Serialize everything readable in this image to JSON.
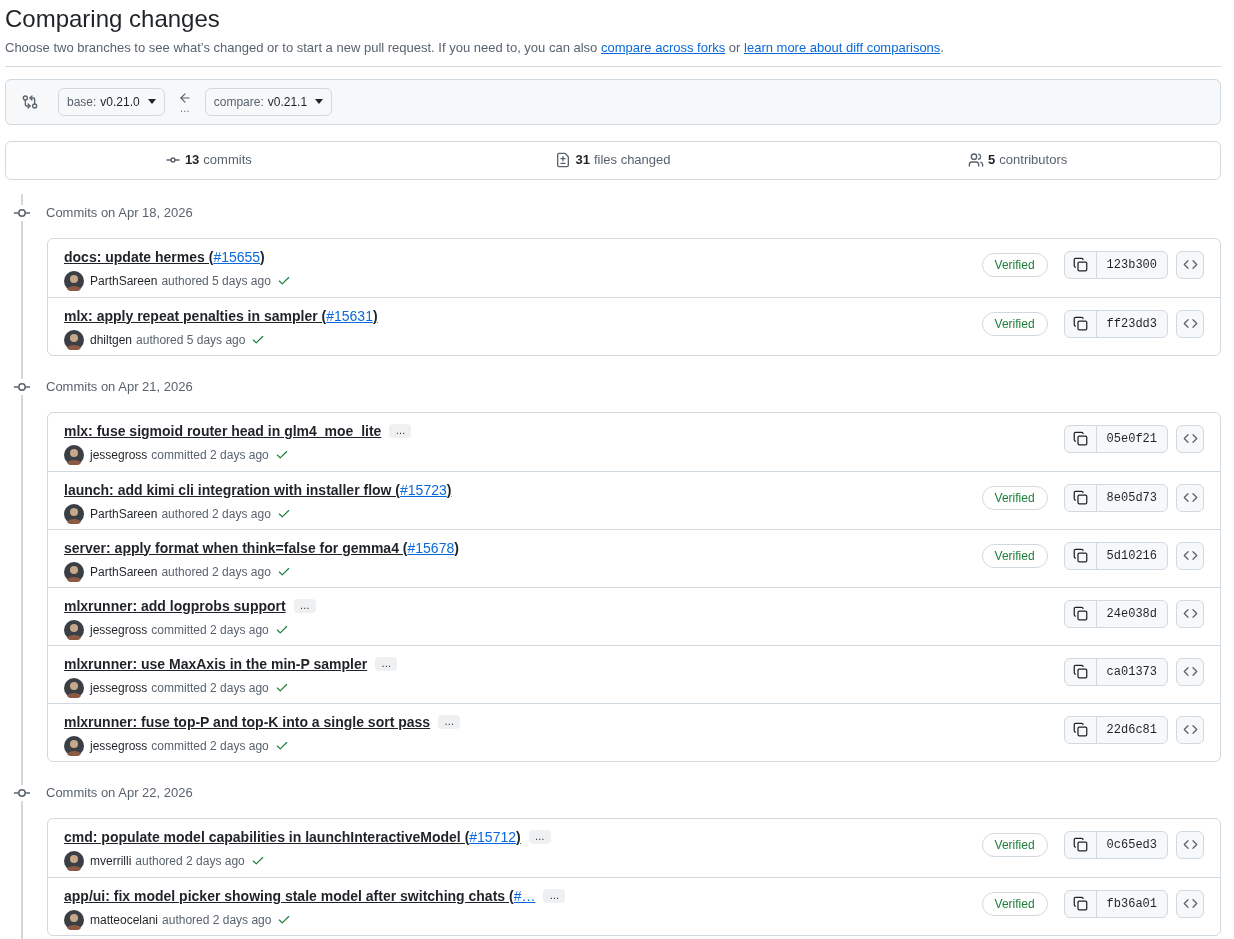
{
  "page": {
    "title": "Comparing changes",
    "description": [
      {
        "kind": "text",
        "text": "Choose two branches to see what’s changed or to start a new pull request. If you need to, you can also "
      },
      {
        "kind": "link",
        "text": "compare across forks"
      },
      {
        "kind": "text",
        "text": " or "
      },
      {
        "kind": "link",
        "text": "learn more about diff comparisons"
      },
      {
        "kind": "text",
        "text": "."
      }
    ]
  },
  "range": {
    "base": {
      "label": "base:",
      "value": "v0.21.0"
    },
    "compare": {
      "label": "compare:",
      "value": "v0.21.1"
    },
    "arrow_caption": "…"
  },
  "summary": [
    {
      "kind": "commits",
      "count": "13",
      "label": "commits"
    },
    {
      "kind": "files",
      "count": "31",
      "label": "files changed"
    },
    {
      "kind": "contributors",
      "count": "5",
      "label": "contributors"
    }
  ],
  "groups": [
    {
      "heading": "Commits on Apr 18, 2026",
      "commits": [
        {
          "title": "docs: update hermes (",
          "pr": "#15655",
          "title_end": ")",
          "author": "ParthSareen",
          "action": "authored",
          "time": "5 days ago",
          "verified": "Verified",
          "sha": "123b300"
        },
        {
          "title": "mlx: apply repeat penalties in sampler (",
          "pr": "#15631",
          "title_end": ")",
          "author": "dhiltgen",
          "action": "authored",
          "time": "5 days ago",
          "verified": "Verified",
          "sha": "ff23dd3"
        }
      ]
    },
    {
      "heading": "Commits on Apr 21, 2026",
      "commits": [
        {
          "title": "mlx: fuse sigmoid router head in glm4_moe_lite",
          "more": "…",
          "author": "jessegross",
          "action": "committed",
          "time": "2 days ago",
          "sha": "05e0f21"
        },
        {
          "title": "launch: add kimi cli integration with installer flow (",
          "pr": "#15723",
          "title_end": ")",
          "author": "ParthSareen",
          "action": "authored",
          "time": "2 days ago",
          "verified": "Verified",
          "sha": "8e05d73"
        },
        {
          "title": "server: apply format when think=false for gemma4 (",
          "pr": "#15678",
          "title_end": ")",
          "author": "ParthSareen",
          "action": "authored",
          "time": "2 days ago",
          "verified": "Verified",
          "sha": "5d10216"
        },
        {
          "title": "mlxrunner: add logprobs support",
          "more": "…",
          "author": "jessegross",
          "action": "committed",
          "time": "2 days ago",
          "sha": "24e038d"
        },
        {
          "title": "mlxrunner: use MaxAxis in the min-P sampler",
          "more": "…",
          "author": "jessegross",
          "action": "committed",
          "time": "2 days ago",
          "sha": "ca01373"
        },
        {
          "title": "mlxrunner: fuse top-P and top-K into a single sort pass",
          "more": "…",
          "author": "jessegross",
          "action": "committed",
          "time": "2 days ago",
          "sha": "22d6c81"
        }
      ]
    },
    {
      "heading": "Commits on Apr 22, 2026",
      "commits": [
        {
          "title": "cmd: populate model capabilities in launchInteractiveModel (",
          "pr": "#15712",
          "title_end": ")",
          "more": "…",
          "author": "mverrilli",
          "action": "authored",
          "time": "2 days ago",
          "verified": "Verified",
          "sha": "0c65ed3"
        },
        {
          "title": "app/ui: fix model picker showing stale model after switching chats (",
          "pr": "#…",
          "more": "…",
          "author": "matteocelani",
          "action": "authored",
          "time": "2 days ago",
          "verified": "Verified",
          "sha": "fb36a01"
        }
      ]
    }
  ]
}
